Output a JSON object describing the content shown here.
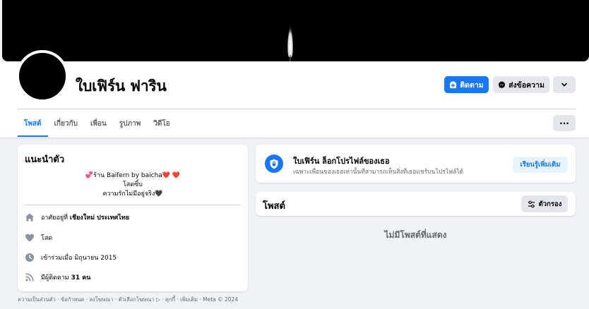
{
  "profile": {
    "name": "ใบเฟิร์น ฟาริน"
  },
  "actions": {
    "follow_label": "ติดตาม",
    "message_label": "ส่งข้อความ"
  },
  "tabs": [
    {
      "label": "โพสต์"
    },
    {
      "label": "เกี่ยวกับ"
    },
    {
      "label": "เพื่อน"
    },
    {
      "label": "รูปภาพ"
    },
    {
      "label": "วิดีโอ"
    }
  ],
  "tabs_more_label": "···",
  "intro": {
    "title": "แนะนำตัว",
    "bio": [
      "💞ร้าน Baifern by baicha❤️ ❤️",
      "โสดซิ้บ",
      "ความรักไม่มีอยู่จริง🖤"
    ],
    "lives_prefix": "อาศัยอยู่ที่ ",
    "lives_place": "เชียงใหม่ ประเทศไทย",
    "relationship": "โสด",
    "joined": "เข้าร่วมเมื่อ มิถุนายน 2015",
    "followers_prefix": "มีผู้ติดตาม ",
    "followers_count": "31 คน"
  },
  "locked": {
    "title": "ใบเฟิร์น ล็อกโปรไฟล์ของเธอ",
    "subtitle": "เฉพาะเพื่อนของเธอเท่านั้นที่สามารถเห็นสิ่งที่เธอแชร์บนโปรไฟล์ได้",
    "learn_more": "เรียนรู้เพิ่มเติม"
  },
  "posts": {
    "title": "โพสต์",
    "filter_label": "ตัวกรอง",
    "empty_text": "ไม่มีโพสต์ที่แสดง"
  },
  "footer": {
    "text": "ความเป็นส่วนตัว · ข้อกำหนด · ลงโฆษณา · ตัวเลือกโฆษณา ▷ · คุกกี้ · เพิ่มเติม · Meta © 2024"
  },
  "colors": {
    "accent": "#1877f2",
    "background": "#f0f2f5",
    "secondary_button": "#e4e6eb"
  },
  "icons": [
    "candle-flame-icon",
    "follow-plus-icon",
    "messenger-icon",
    "chevron-down-icon",
    "more-dots-icon",
    "home-icon",
    "heart-icon",
    "clock-icon",
    "rss-icon",
    "shield-lock-icon",
    "filter-icon"
  ]
}
